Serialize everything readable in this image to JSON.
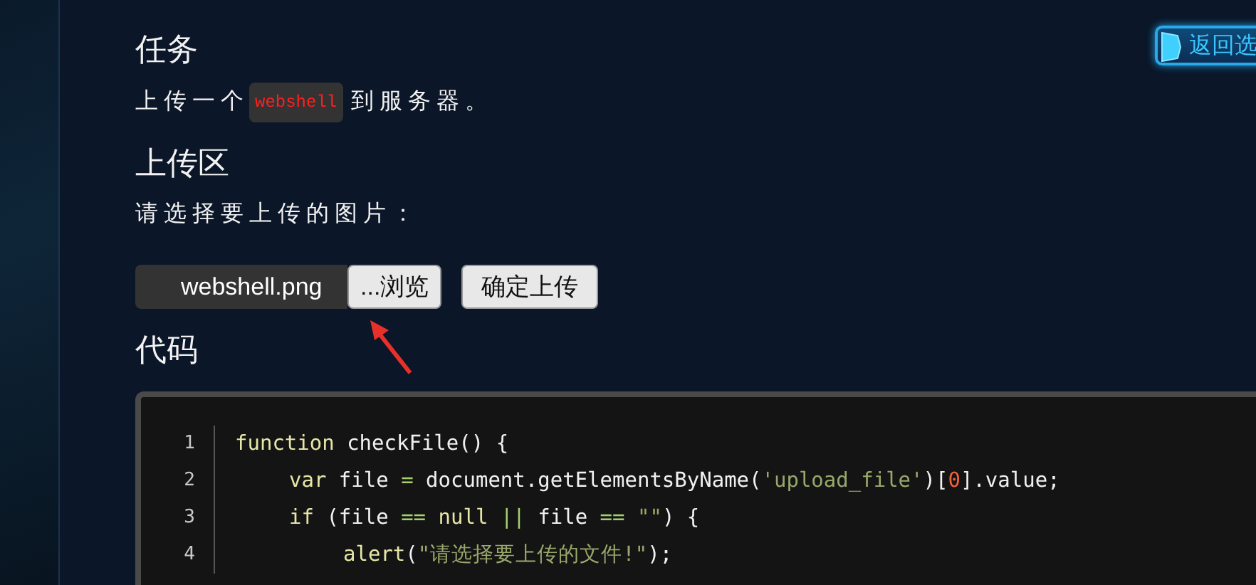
{
  "return_button": {
    "label": "返回选"
  },
  "task": {
    "heading": "任务",
    "text_before": "上传一个",
    "code_word": "webshell",
    "text_after": "到服务器。"
  },
  "upload": {
    "heading": "上传区",
    "prompt": "请选择要上传的图片：",
    "file_value": "webshell.png",
    "browse_label": "...浏览",
    "submit_label": "确定上传"
  },
  "code": {
    "heading": "代码",
    "lines": [
      {
        "number": "1",
        "tokens": [
          {
            "kind": "kw",
            "text": "function"
          },
          {
            "kind": "plain",
            "text": " checkFile() {"
          }
        ],
        "children": [
          {
            "number": "2",
            "tokens": [
              {
                "kind": "kw",
                "text": "var"
              },
              {
                "kind": "plain",
                "text": " file "
              },
              {
                "kind": "op",
                "text": "="
              },
              {
                "kind": "plain",
                "text": " document.getElementsByName("
              },
              {
                "kind": "str",
                "text": "'upload_file'"
              },
              {
                "kind": "plain",
                "text": ")["
              },
              {
                "kind": "num",
                "text": "0"
              },
              {
                "kind": "plain",
                "text": "].value;"
              }
            ]
          },
          {
            "number": "3",
            "tokens": [
              {
                "kind": "kw",
                "text": "if"
              },
              {
                "kind": "plain",
                "text": " (file "
              },
              {
                "kind": "op",
                "text": "== "
              },
              {
                "kind": "kw",
                "text": "null "
              },
              {
                "kind": "op",
                "text": "||"
              },
              {
                "kind": "plain",
                "text": " file "
              },
              {
                "kind": "op",
                "text": "== "
              },
              {
                "kind": "str",
                "text": "\"\""
              },
              {
                "kind": "plain",
                "text": ") {"
              }
            ],
            "children": [
              {
                "number": "4",
                "tokens": [
                  {
                    "kind": "kw",
                    "text": "alert"
                  },
                  {
                    "kind": "plain",
                    "text": "("
                  },
                  {
                    "kind": "str",
                    "text": "\"请选择要上传的文件!\""
                  },
                  {
                    "kind": "plain",
                    "text": ");"
                  }
                ]
              }
            ]
          }
        ]
      }
    ]
  }
}
